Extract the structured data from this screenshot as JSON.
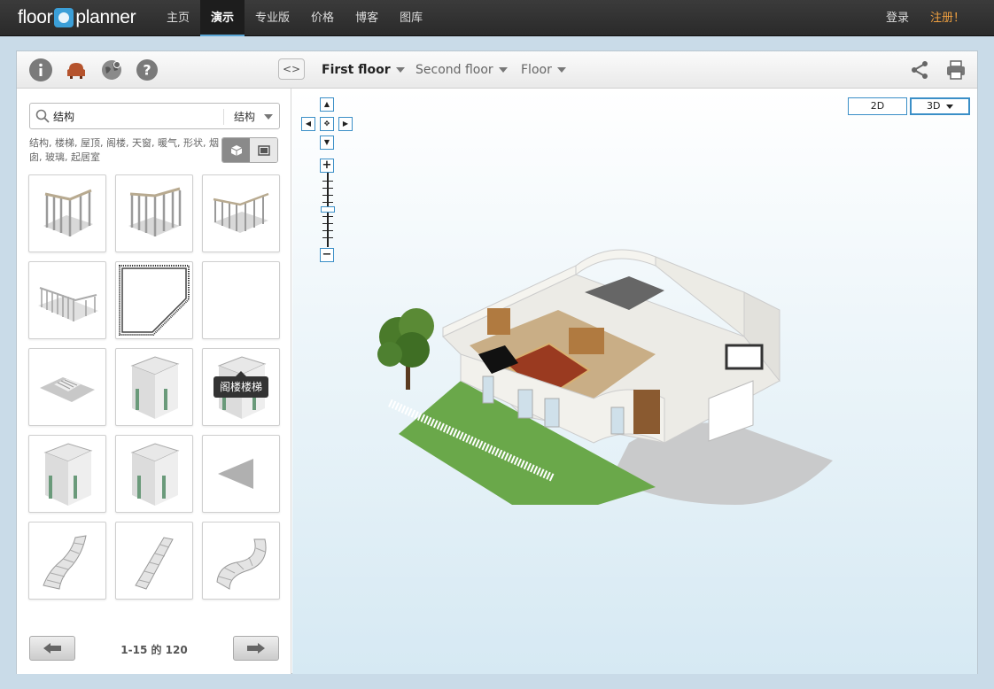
{
  "topnav": {
    "logo_left": "floor",
    "logo_right": "planner",
    "items": [
      {
        "label": "主页"
      },
      {
        "label": "演示"
      },
      {
        "label": "专业版"
      },
      {
        "label": "价格"
      },
      {
        "label": "博客"
      },
      {
        "label": "图库"
      }
    ],
    "active_index": 1,
    "login": "登录",
    "signup": "注册！"
  },
  "toolbar": {
    "icons": [
      "info-icon",
      "furniture-icon",
      "settings-globe-icon",
      "help-icon"
    ],
    "collapse_label": "<>",
    "floors": [
      {
        "label": "First floor",
        "active": true
      },
      {
        "label": "Second floor",
        "active": false
      },
      {
        "label": "Floor",
        "active": false
      }
    ],
    "right_icons": [
      "share-icon",
      "print-icon"
    ]
  },
  "sidebar": {
    "search_value": "结构",
    "category": "结构",
    "tags": "结构, 楼梯, 屋顶, 阁楼, 天窗, 暖气, 形状, 烟囱, 玻璃, 起居室",
    "tooltip": "阁楼楼梯",
    "pager": "1-15 的 120"
  },
  "canvas": {
    "mode_2d": "2D",
    "mode_3d": "3D"
  },
  "colors": {
    "accent": "#3b8fc7",
    "signup": "#f0a040",
    "nav_bg": "#2f2f2f"
  }
}
